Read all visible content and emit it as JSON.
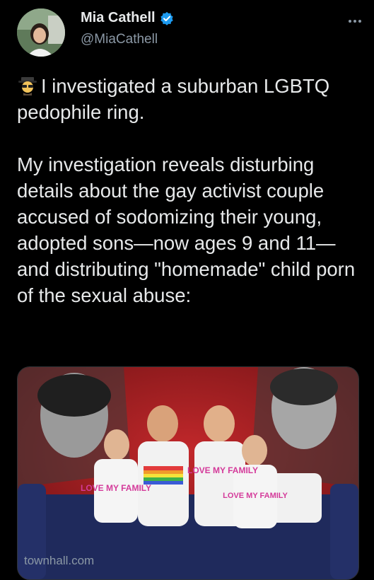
{
  "author": {
    "name": "Mia Cathell",
    "handle": "@MiaCathell",
    "verified_color": "#1d9bf0"
  },
  "tweet": {
    "emoji_icon": "detective-spy-icon",
    "paragraph1": "I investigated a suburban LGBTQ pedophile ring.",
    "paragraph2": "My investigation reveals disturbing details about the gay activist couple accused of sodomizing their young, adopted sons—now ages 9 and 11—and distributing \"homemade\" child porn of the sexual abuse:"
  },
  "card": {
    "image_alt_icon": "news-photo",
    "shirt_text": "LOVE MY FAMILY",
    "domain": "townhall.com"
  },
  "colors": {
    "background": "#000000",
    "text": "#e7e9ea",
    "muted": "#8b98a5",
    "accent": "#1d9bf0",
    "card_red": "#a31e22"
  }
}
